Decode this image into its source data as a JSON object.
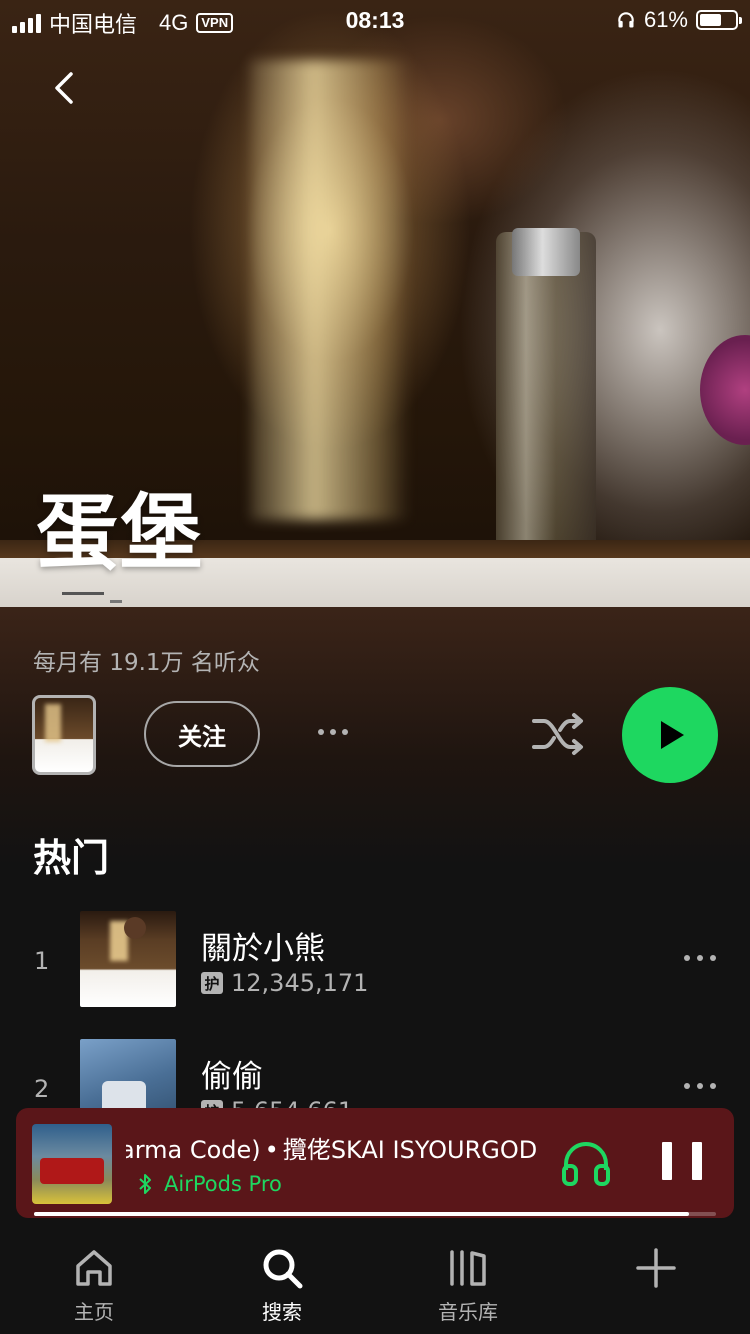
{
  "status_bar": {
    "carrier": "中国电信",
    "network": "4G",
    "vpn": "VPN",
    "time": "08:13",
    "battery": "61%",
    "battery_level": 0.61
  },
  "artist": {
    "name": "蛋堡",
    "monthly_listeners": "每月有 19.1万 名听众"
  },
  "actions": {
    "follow_label": "关注"
  },
  "popular": {
    "title": "热门",
    "tracks": [
      {
        "rank": "1",
        "title": "關於小熊",
        "badge": "护",
        "plays": "12,345,171"
      },
      {
        "rank": "2",
        "title": "偷偷",
        "badge": "护",
        "plays": "5,654,661"
      }
    ]
  },
  "now_playing": {
    "title_visible": "arma Code)",
    "separator": "•",
    "artist": "攬佬SKAI ISYOURGOD",
    "device": "AirPods Pro",
    "progress": 0.96,
    "accent_color": "#1ed760",
    "background_color": "#5a1619"
  },
  "bottom_nav": {
    "items": [
      {
        "label": "主页",
        "icon": "home-icon"
      },
      {
        "label": "搜索",
        "icon": "search-icon"
      },
      {
        "label": "音乐库",
        "icon": "library-icon"
      },
      {
        "label": "",
        "icon": "add-icon"
      }
    ]
  },
  "colors": {
    "accent": "#1ed760",
    "background": "#121212",
    "text_secondary": "#b3b3b3"
  }
}
